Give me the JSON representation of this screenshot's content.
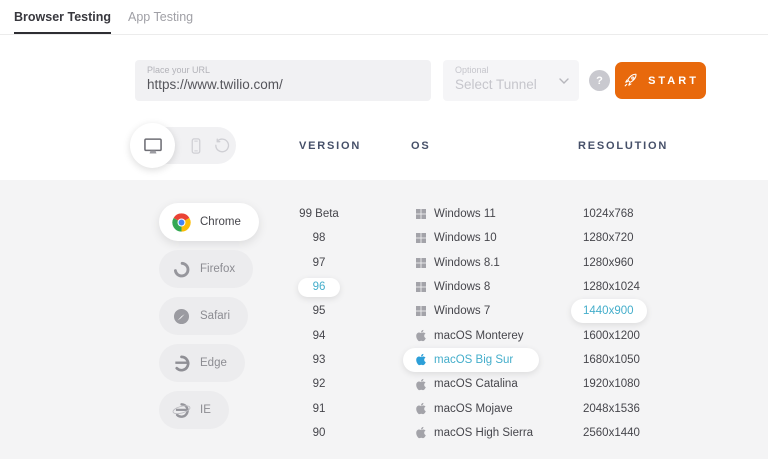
{
  "tabs": [
    {
      "label": "Browser Testing",
      "active": true
    },
    {
      "label": "App Testing",
      "active": false
    }
  ],
  "form": {
    "url_label": "Place your URL",
    "url_value": "https://www.twilio.com/",
    "tunnel_label": "Optional",
    "tunnel_value": "Select Tunnel",
    "help_text": "?",
    "start_label": "START"
  },
  "device_toggle": [
    {
      "icon": "desktop-icon",
      "selected": true
    },
    {
      "icon": "mobile-icon",
      "selected": false
    },
    {
      "icon": "history-icon",
      "selected": false
    }
  ],
  "columns": {
    "version": "VERSION",
    "os": "OS",
    "resolution": "RESOLUTION"
  },
  "browsers": [
    {
      "label": "Chrome",
      "icon": "chrome-icon",
      "selected": true
    },
    {
      "label": "Firefox",
      "icon": "firefox-icon",
      "selected": false
    },
    {
      "label": "Safari",
      "icon": "safari-icon",
      "selected": false
    },
    {
      "label": "Edge",
      "icon": "edge-icon",
      "selected": false
    },
    {
      "label": "IE",
      "icon": "ie-icon",
      "selected": false
    }
  ],
  "versions": [
    {
      "label": "99 Beta",
      "selected": false
    },
    {
      "label": "98",
      "selected": false
    },
    {
      "label": "97",
      "selected": false
    },
    {
      "label": "96",
      "selected": true
    },
    {
      "label": "95",
      "selected": false
    },
    {
      "label": "94",
      "selected": false
    },
    {
      "label": "93",
      "selected": false
    },
    {
      "label": "92",
      "selected": false
    },
    {
      "label": "91",
      "selected": false
    },
    {
      "label": "90",
      "selected": false
    }
  ],
  "os_list": [
    {
      "label": "Windows 11",
      "icon": "windows-icon",
      "selected": false
    },
    {
      "label": "Windows 10",
      "icon": "windows-icon",
      "selected": false
    },
    {
      "label": "Windows 8.1",
      "icon": "windows-icon",
      "selected": false
    },
    {
      "label": "Windows 8",
      "icon": "windows-icon",
      "selected": false
    },
    {
      "label": "Windows 7",
      "icon": "windows-icon",
      "selected": false
    },
    {
      "label": "macOS Monterey",
      "icon": "apple-icon",
      "selected": false
    },
    {
      "label": "macOS Big Sur",
      "icon": "apple-icon",
      "selected": true
    },
    {
      "label": "macOS Catalina",
      "icon": "apple-icon",
      "selected": false
    },
    {
      "label": "macOS Mojave",
      "icon": "apple-icon",
      "selected": false
    },
    {
      "label": "macOS High Sierra",
      "icon": "apple-icon",
      "selected": false
    }
  ],
  "resolutions": [
    {
      "label": "1024x768",
      "selected": false
    },
    {
      "label": "1280x720",
      "selected": false
    },
    {
      "label": "1280x960",
      "selected": false
    },
    {
      "label": "1280x1024",
      "selected": false
    },
    {
      "label": "1440x900",
      "selected": true
    },
    {
      "label": "1600x1200",
      "selected": false
    },
    {
      "label": "1680x1050",
      "selected": false
    },
    {
      "label": "1920x1080",
      "selected": false
    },
    {
      "label": "2048x1536",
      "selected": false
    },
    {
      "label": "2560x1440",
      "selected": false
    }
  ],
  "colors": {
    "accent_cyan": "#45aecb",
    "brand_orange": "#e8690c",
    "header_navy": "#465069",
    "content_bg": "#f4f4f5"
  }
}
